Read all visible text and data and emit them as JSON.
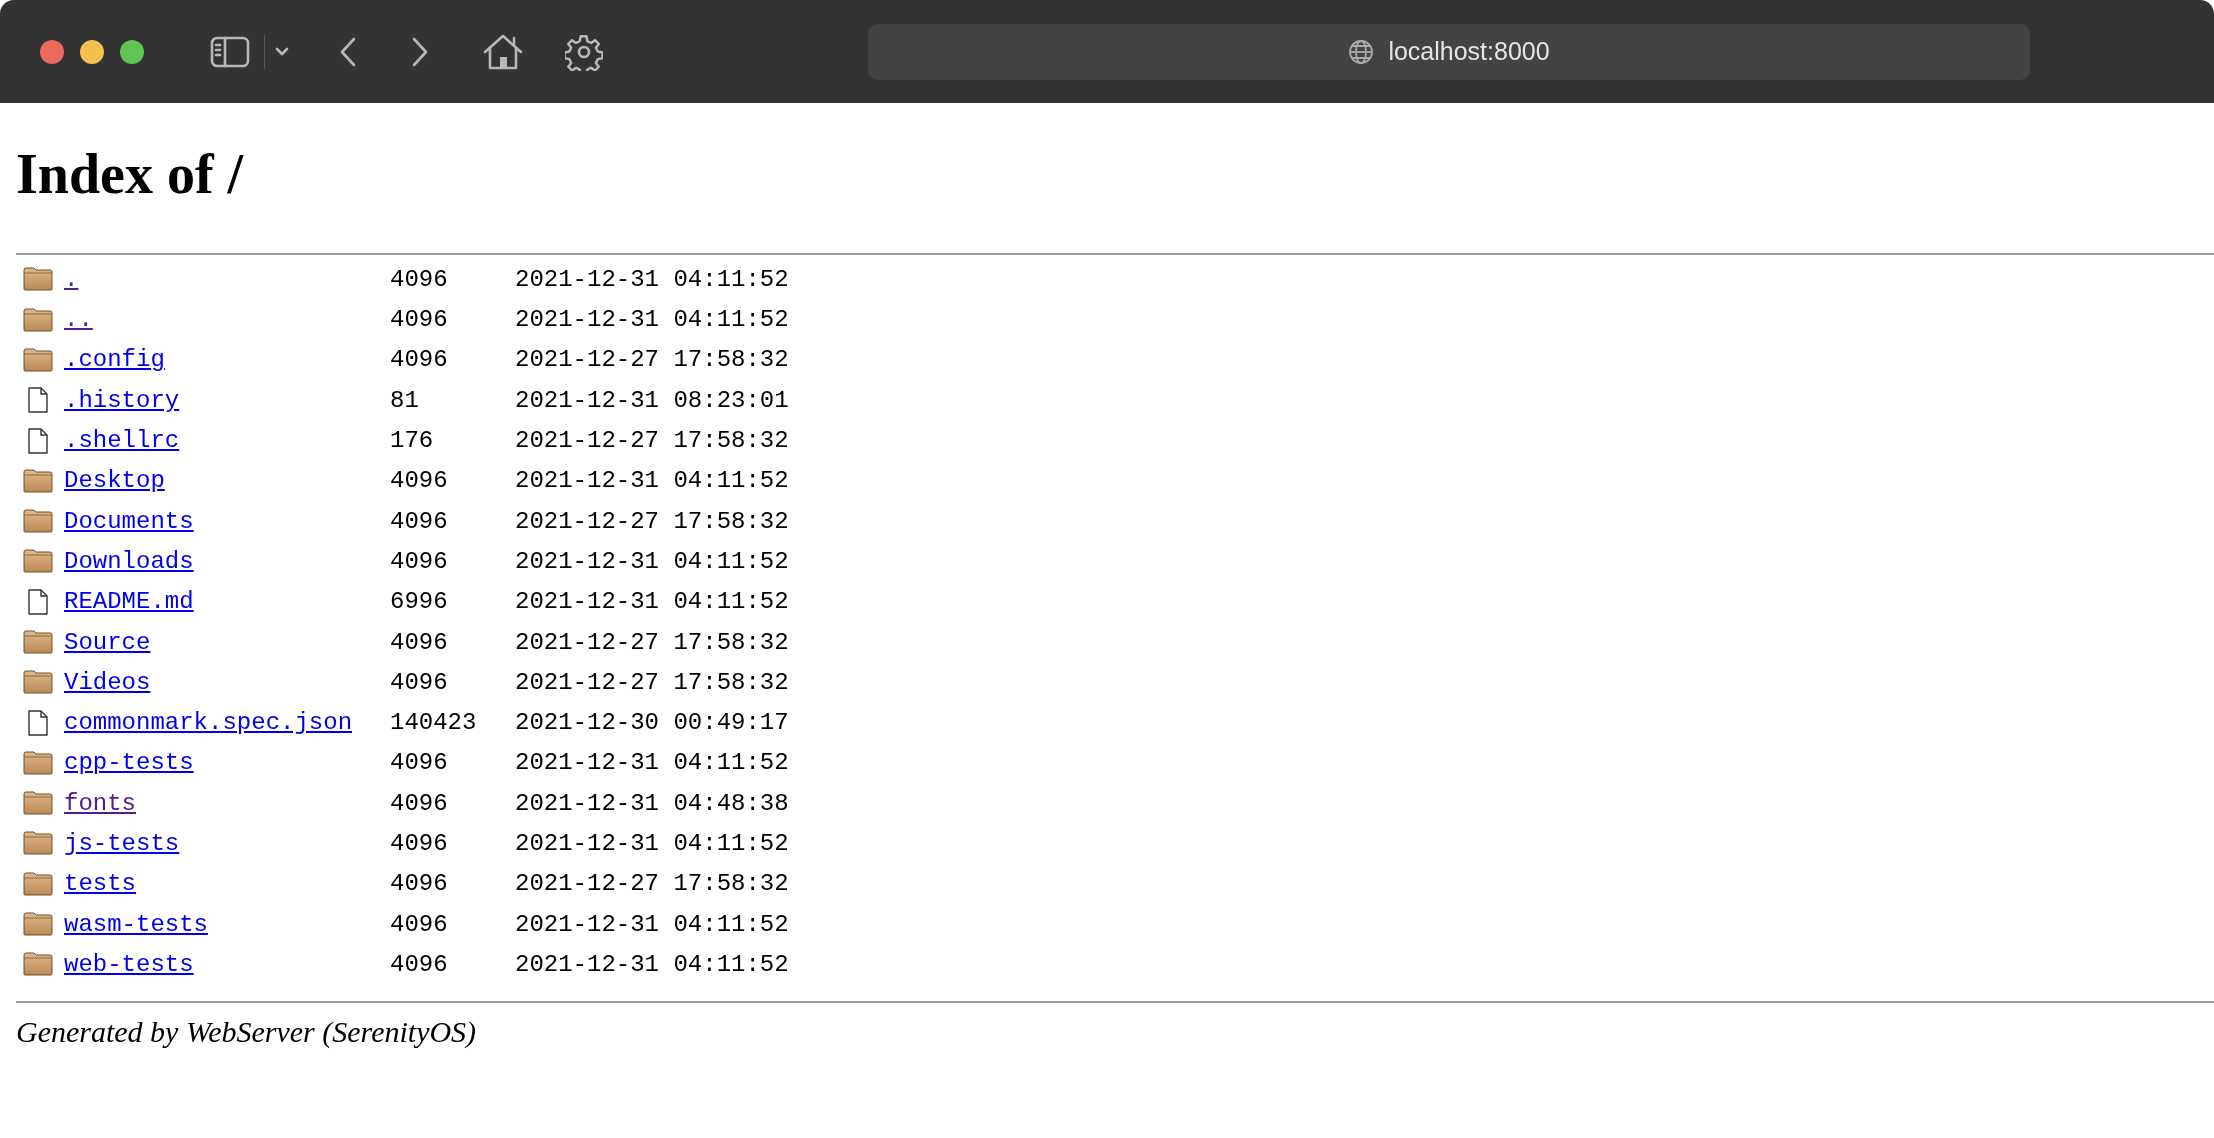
{
  "browser": {
    "address": "localhost:8000"
  },
  "heading": "Index of /",
  "entries": [
    {
      "kind": "folder",
      "name": ".",
      "size": "4096",
      "modified": "2021-12-31 04:11:52",
      "visited": true
    },
    {
      "kind": "folder",
      "name": "..",
      "size": "4096",
      "modified": "2021-12-31 04:11:52",
      "visited": true
    },
    {
      "kind": "folder",
      "name": ".config",
      "size": "4096",
      "modified": "2021-12-27 17:58:32",
      "visited": false
    },
    {
      "kind": "file",
      "name": ".history",
      "size": "81",
      "modified": "2021-12-31 08:23:01",
      "visited": false
    },
    {
      "kind": "file",
      "name": ".shellrc",
      "size": "176",
      "modified": "2021-12-27 17:58:32",
      "visited": false
    },
    {
      "kind": "folder",
      "name": "Desktop",
      "size": "4096",
      "modified": "2021-12-31 04:11:52",
      "visited": false
    },
    {
      "kind": "folder",
      "name": "Documents",
      "size": "4096",
      "modified": "2021-12-27 17:58:32",
      "visited": false
    },
    {
      "kind": "folder",
      "name": "Downloads",
      "size": "4096",
      "modified": "2021-12-31 04:11:52",
      "visited": false
    },
    {
      "kind": "file",
      "name": "README.md",
      "size": "6996",
      "modified": "2021-12-31 04:11:52",
      "visited": false
    },
    {
      "kind": "folder",
      "name": "Source",
      "size": "4096",
      "modified": "2021-12-27 17:58:32",
      "visited": false
    },
    {
      "kind": "folder",
      "name": "Videos",
      "size": "4096",
      "modified": "2021-12-27 17:58:32",
      "visited": false
    },
    {
      "kind": "file",
      "name": "commonmark.spec.json",
      "size": "140423",
      "modified": "2021-12-30 00:49:17",
      "visited": false
    },
    {
      "kind": "folder",
      "name": "cpp-tests",
      "size": "4096",
      "modified": "2021-12-31 04:11:52",
      "visited": false
    },
    {
      "kind": "folder",
      "name": "fonts",
      "size": "4096",
      "modified": "2021-12-31 04:48:38",
      "visited": true
    },
    {
      "kind": "folder",
      "name": "js-tests",
      "size": "4096",
      "modified": "2021-12-31 04:11:52",
      "visited": false
    },
    {
      "kind": "folder",
      "name": "tests",
      "size": "4096",
      "modified": "2021-12-27 17:58:32",
      "visited": false
    },
    {
      "kind": "folder",
      "name": "wasm-tests",
      "size": "4096",
      "modified": "2021-12-31 04:11:52",
      "visited": false
    },
    {
      "kind": "folder",
      "name": "web-tests",
      "size": "4096",
      "modified": "2021-12-31 04:11:52",
      "visited": false
    }
  ],
  "footer": "Generated by WebServer (SerenityOS)"
}
